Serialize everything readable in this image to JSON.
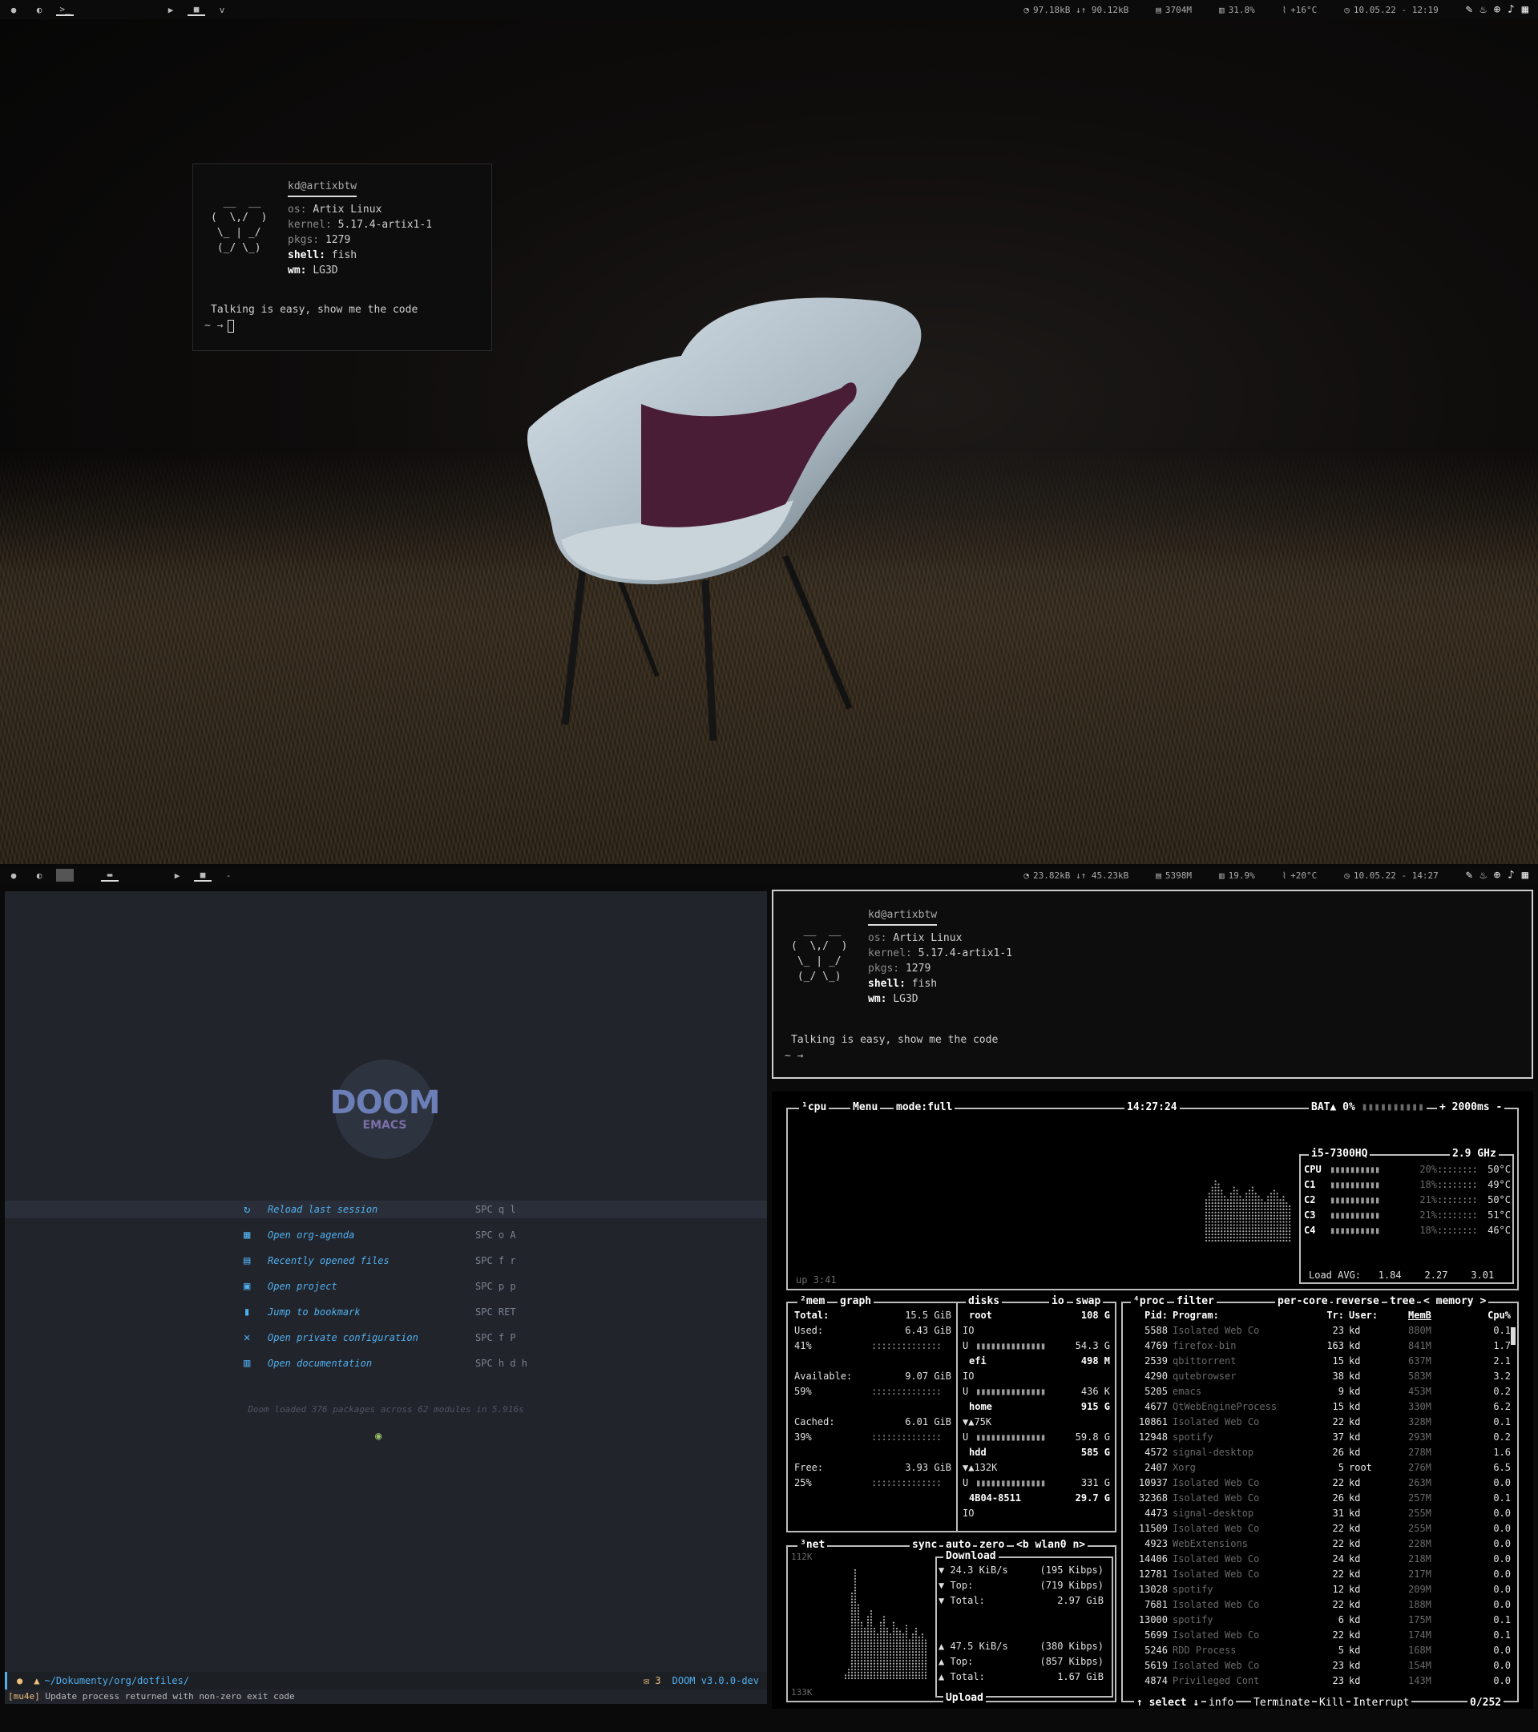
{
  "top_bar": {
    "workspaces": [
      "●",
      "◐",
      ">_"
    ],
    "media": [
      "▶",
      "■",
      "v"
    ],
    "net": "97.18kB ↓↑ 90.12kB",
    "mem": "3704M",
    "cpu": "31.8%",
    "temp": "+16°C",
    "clock": "10.05.22 - 12:19"
  },
  "fetch_top": {
    "user": "kd@artixbtw",
    "logo": "  __  __\n(  \\,/  )\n \\_ | _/\n (_/ \\_)",
    "os_key": "os:",
    "os": "Artix Linux",
    "kernel_key": "kernel:",
    "kernel": "5.17.4-artix1-1",
    "pkgs_key": "pkgs:",
    "pkgs": "1279",
    "shell_key": "shell:",
    "shell": "fish",
    "wm_key": "wm:",
    "wm": "LG3D",
    "quote": "Talking is easy, show me the code",
    "prompt": "~ →"
  },
  "bottom_bar": {
    "workspaces": [
      "●",
      "◐",
      "",
      "▬"
    ],
    "media": [
      "▶",
      "■",
      "-"
    ],
    "net": "23.82kB ↓↑ 45.23kB",
    "mem": "5398M",
    "cpu": "19.9%",
    "temp": "+20°C",
    "clock": "10.05.22 - 14:27"
  },
  "emacs": {
    "logo_top": "DOOM",
    "logo_bottom": "EMACS",
    "menu": [
      {
        "label": "Reload last session",
        "key": "SPC q l"
      },
      {
        "label": "Open org-agenda",
        "key": "SPC o A"
      },
      {
        "label": "Recently opened files",
        "key": "SPC f r"
      },
      {
        "label": "Open project",
        "key": "SPC p p"
      },
      {
        "label": "Jump to bookmark",
        "key": "SPC RET"
      },
      {
        "label": "Open private configuration",
        "key": "SPC f P"
      },
      {
        "label": "Open documentation",
        "key": "SPC h d h"
      }
    ],
    "loaded": "Doom loaded 376 packages across 62 modules in 5.916s",
    "modeline_path": "~/Dokumenty/org/dotfiles/",
    "modeline_mail": "3",
    "modeline_version": "DOOM v3.0.0-dev",
    "echo_tag": "[mu4e]",
    "echo_msg": "Update process returned with non-zero exit code"
  },
  "fetch_bottom": {
    "user": "kd@artixbtw",
    "logo": "  __  __\n(  \\,/  )\n \\_ | _/\n (_/ \\_)",
    "os_key": "os:",
    "os": "Artix Linux",
    "kernel_key": "kernel:",
    "kernel": "5.17.4-artix1-1",
    "pkgs_key": "pkgs:",
    "pkgs": "1279",
    "shell_key": "shell:",
    "shell": "fish",
    "wm_key": "wm:",
    "wm": "LG3D",
    "quote": "Talking is easy, show me the code",
    "prompt": "~ →"
  },
  "btop": {
    "cpu_title": "¹cpu",
    "menu": "Menu",
    "mode": "mode:full",
    "time": "14:27:24",
    "bat": "BAT▲ 0%",
    "interval": "2000ms",
    "uptime": "up 3:41",
    "cpu_model": "i5-7300HQ",
    "freq": "2.9 GHz",
    "cores": [
      {
        "name": "CPU",
        "pct": "20%",
        "temp": "50°C"
      },
      {
        "name": "C1",
        "pct": "18%",
        "temp": "49°C"
      },
      {
        "name": "C2",
        "pct": "21%",
        "temp": "50°C"
      },
      {
        "name": "C3",
        "pct": "21%",
        "temp": "51°C"
      },
      {
        "name": "C4",
        "pct": "18%",
        "temp": "46°C"
      }
    ],
    "load_label": "Load AVG:",
    "load": [
      "1.84",
      "2.27",
      "3.01"
    ],
    "mem_title": "²mem",
    "mem_graph": "graph",
    "mem": [
      {
        "k": "Total:",
        "v": "15.5 GiB",
        "p": ""
      },
      {
        "k": "Used:",
        "v": "6.43 GiB",
        "p": "41%"
      },
      {
        "k": "Available:",
        "v": "9.07 GiB",
        "p": "59%"
      },
      {
        "k": "Cached:",
        "v": "6.01 GiB",
        "p": "39%"
      },
      {
        "k": "Free:",
        "v": "3.93 GiB",
        "p": "25%"
      }
    ],
    "disks_title": "disks",
    "io": "io",
    "swap": "swap",
    "disks": [
      {
        "name": "root",
        "size": "108 G",
        "io": "IO",
        "u": "54.3 G"
      },
      {
        "name": "efi",
        "size": "498 M",
        "io": "IO",
        "u": "436 K"
      },
      {
        "name": "home",
        "size": "915 G",
        "io": "▼▲75K",
        "u": "59.8 G"
      },
      {
        "name": "hdd",
        "size": "585 G",
        "io": "▼▲132K",
        "u": "331 G"
      },
      {
        "name": "4B04-8511",
        "size": "29.7 G",
        "io": "IO",
        "u": ""
      }
    ],
    "net_title": "³net",
    "net_sync": "sync",
    "net_auto": "auto",
    "net_zero": "zero",
    "net_iface": "<b wlan0 n>",
    "net_top": "112K",
    "net_bottom": "133K",
    "download_label": "Download",
    "upload_label": "Upload",
    "down": [
      {
        "k": "▼ 24.3 KiB/s",
        "v": "(195 Kibps)"
      },
      {
        "k": "▼ Top:",
        "v": "(719 Kibps)"
      },
      {
        "k": "▼ Total:",
        "v": "2.97 GiB"
      }
    ],
    "up": [
      {
        "k": "▲ 47.5 KiB/s",
        "v": "(380 Kibps)"
      },
      {
        "k": "▲ Top:",
        "v": "(857 Kibps)"
      },
      {
        "k": "▲ Total:",
        "v": "1.67 GiB"
      }
    ],
    "proc_title": "⁴proc",
    "proc_filter": "filter",
    "proc_percore": "per-core",
    "proc_reverse": "reverse",
    "proc_tree": "tree",
    "proc_sort": "< memory >",
    "proc_headers": [
      "Pid:",
      "Program:",
      "Tr:",
      "User:",
      "MemB",
      "Cpu%"
    ],
    "procs": [
      [
        "5588",
        "Isolated Web Co",
        "23",
        "kd",
        "880M",
        "0.1"
      ],
      [
        "4769",
        "firefox-bin",
        "163",
        "kd",
        "841M",
        "1.7"
      ],
      [
        "2539",
        "qbittorrent",
        "15",
        "kd",
        "637M",
        "2.1"
      ],
      [
        "4290",
        "qutebrowser",
        "38",
        "kd",
        "583M",
        "3.2"
      ],
      [
        "5205",
        "emacs",
        "9",
        "kd",
        "453M",
        "0.2"
      ],
      [
        "4677",
        "QtWebEngineProcess",
        "15",
        "kd",
        "330M",
        "6.2"
      ],
      [
        "10861",
        "Isolated Web Co",
        "22",
        "kd",
        "328M",
        "0.1"
      ],
      [
        "12948",
        "spotify",
        "37",
        "kd",
        "293M",
        "0.2"
      ],
      [
        "4572",
        "signal-desktop",
        "26",
        "kd",
        "278M",
        "1.6"
      ],
      [
        "2407",
        "Xorg",
        "5",
        "root",
        "276M",
        "6.5"
      ],
      [
        "10937",
        "Isolated Web Co",
        "22",
        "kd",
        "263M",
        "0.0"
      ],
      [
        "32368",
        "Isolated Web Co",
        "26",
        "kd",
        "257M",
        "0.1"
      ],
      [
        "4473",
        "signal-desktop",
        "31",
        "kd",
        "255M",
        "0.0"
      ],
      [
        "11509",
        "Isolated Web Co",
        "22",
        "kd",
        "255M",
        "0.0"
      ],
      [
        "4923",
        "WebExtensions",
        "22",
        "kd",
        "228M",
        "0.0"
      ],
      [
        "14406",
        "Isolated Web Co",
        "24",
        "kd",
        "218M",
        "0.0"
      ],
      [
        "12781",
        "Isolated Web Co",
        "22",
        "kd",
        "217M",
        "0.0"
      ],
      [
        "13028",
        "spotify",
        "12",
        "kd",
        "209M",
        "0.0"
      ],
      [
        "7681",
        "Isolated Web Co",
        "22",
        "kd",
        "188M",
        "0.0"
      ],
      [
        "13000",
        "spotify",
        "6",
        "kd",
        "175M",
        "0.1"
      ],
      [
        "5699",
        "Isolated Web Co",
        "22",
        "kd",
        "174M",
        "0.1"
      ],
      [
        "5246",
        "RDD Process",
        "5",
        "kd",
        "168M",
        "0.0"
      ],
      [
        "5619",
        "Isolated Web Co",
        "23",
        "kd",
        "154M",
        "0.0"
      ],
      [
        "4874",
        "Privileged Cont",
        "23",
        "kd",
        "143M",
        "0.0"
      ]
    ],
    "proc_footer_select": "select",
    "proc_footer_info": "info",
    "proc_footer_terminate": "Terminate",
    "proc_footer_kill": "Kill",
    "proc_footer_interrupt": "Interrupt",
    "proc_count": "0/252"
  }
}
